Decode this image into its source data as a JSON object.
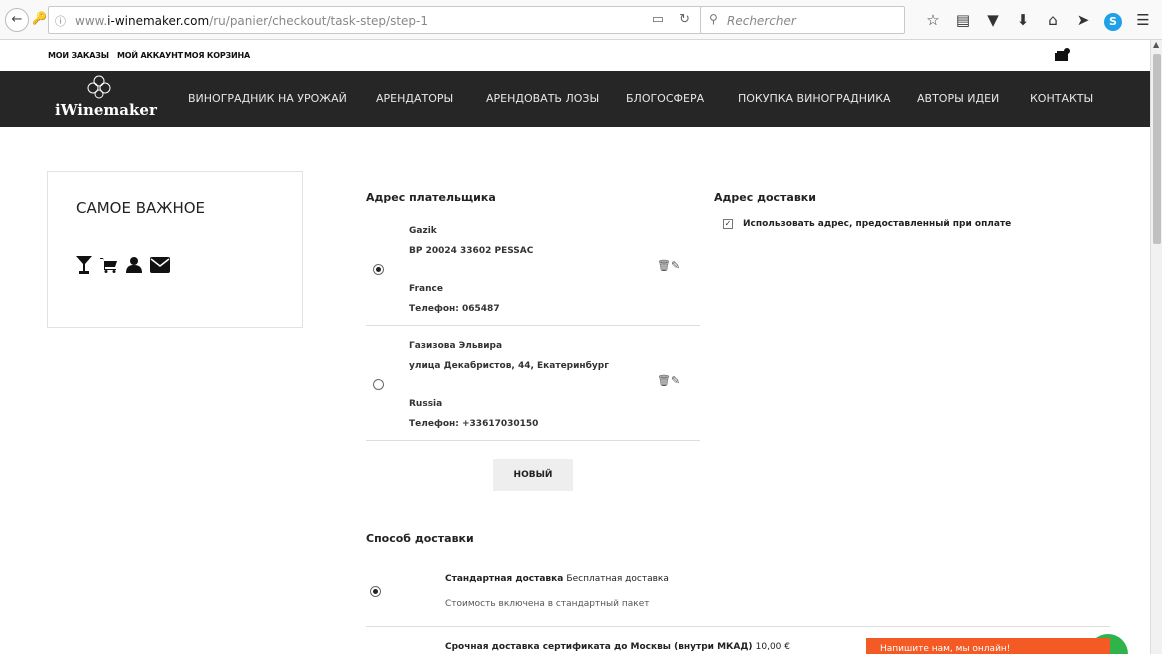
{
  "browser": {
    "url_prefix": "www.",
    "url_domain": "i-winemaker.com",
    "url_path": "/ru/panier/checkout/task-step/step-1",
    "search_placeholder": "Rechercher",
    "toolbar_icons": [
      "star-icon",
      "reading-list-icon",
      "pocket-icon",
      "download-icon",
      "home-icon",
      "send-icon",
      "skype-icon",
      "menu-icon"
    ]
  },
  "toplinks": {
    "orders": "МОИ ЗАКАЗЫ",
    "account": "МОЙ АККАУНТ",
    "cart": "МОЯ КОРЗИНА"
  },
  "logo": {
    "text": "iWinemaker"
  },
  "nav": {
    "items": [
      "ВИНОГРАДНИК НА УРОЖАЙ",
      "АРЕНДАТОРЫ",
      "АРЕНДОВАТЬ ЛОЗЫ",
      "БЛОГОСФЕРА",
      "ПОКУПКА ВИНОГРАДНИКА",
      "АВТОРЫ ИДЕИ",
      "КОНТАКТЫ"
    ]
  },
  "sidebar": {
    "title": "САМОЕ ВАЖНОЕ",
    "icons": [
      "glass-icon",
      "cart-icon",
      "user-icon",
      "envelope-icon"
    ]
  },
  "billing": {
    "title": "Адрес плательщика",
    "addresses": [
      {
        "name": "Gazik",
        "street": "BP 20024 33602 PESSAC",
        "country": "France",
        "phone": "Телефон: 065487",
        "selected": true
      },
      {
        "name": "Газизова Эльвира",
        "street": "улица Декабристов, 44, Екатеринбург",
        "country": "Russia",
        "phone": "Телефон: +33617030150",
        "selected": false
      }
    ],
    "new_button": "НОВЫЙ"
  },
  "delivery": {
    "title": "Адрес доставки",
    "use_billing_label": "Использовать адрес, предоставленный при оплате",
    "use_billing_checked": true
  },
  "shipping": {
    "title": "Способ доставки",
    "options": [
      {
        "name": "Стандартная доставка",
        "price": "Бесплатная доставка",
        "desc": "Стоимость включена в стандартный пакет",
        "selected": true
      },
      {
        "name": "Срочная доставка сертификата до Москвы (внутри МКАД)",
        "price": "10,00 €",
        "selected": false
      }
    ]
  },
  "chat": {
    "label": "Напишите нам, мы онлайн!"
  }
}
